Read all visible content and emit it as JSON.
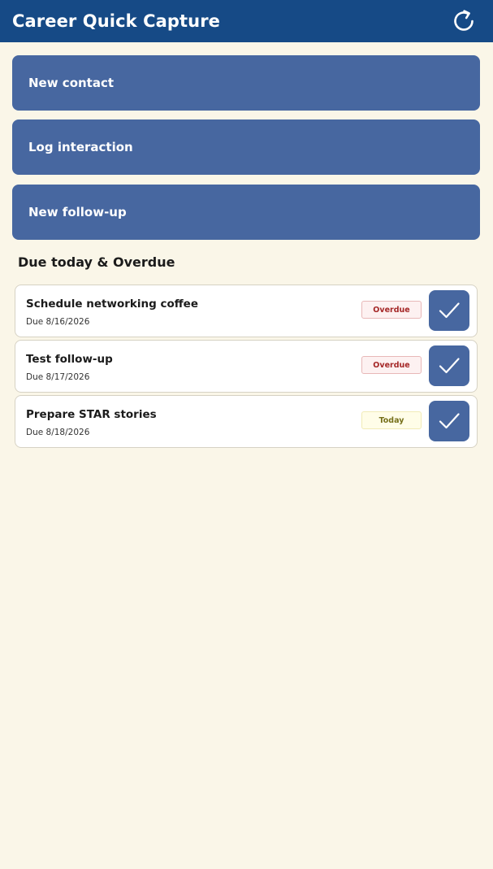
{
  "header": {
    "title": "Career Quick Capture",
    "refresh_icon": "refresh-icon"
  },
  "actions": {
    "new_contact": "New contact",
    "log_interaction": "Log interaction",
    "new_follow_up": "New follow-up"
  },
  "due_section": {
    "title": "Due today & Overdue",
    "tasks": [
      {
        "title": "Schedule networking coffee",
        "due": "Due 8/16/2026",
        "status": "Overdue",
        "complete_icon": "checkmark-icon"
      },
      {
        "title": "Test follow-up",
        "due": "Due 8/17/2026",
        "status": "Overdue",
        "complete_icon": "checkmark-icon"
      },
      {
        "title": "Prepare STAR stories",
        "due": "Due 8/18/2026",
        "status": "Today",
        "complete_icon": "checkmark-icon"
      }
    ]
  },
  "colors": {
    "header_bg": "#164a86",
    "button_bg": "#4767a0",
    "page_bg": "#faf6e8",
    "overdue_text": "#a52828",
    "today_text": "#76701a"
  }
}
